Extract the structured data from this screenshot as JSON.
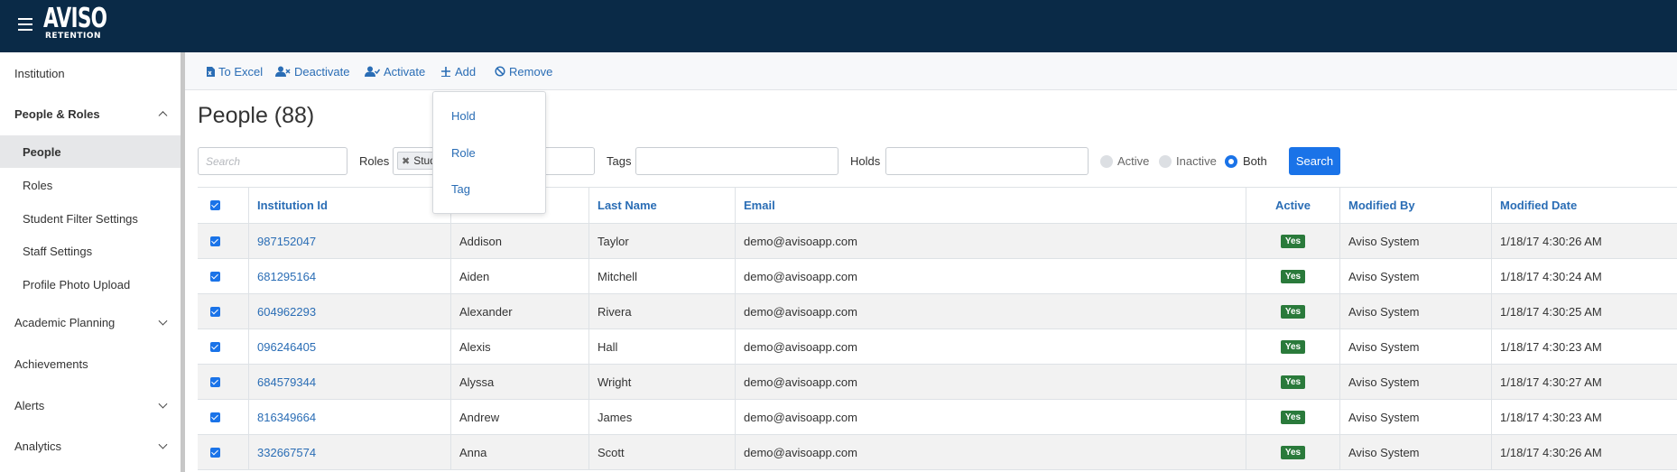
{
  "app": {
    "logo_main": "AVISO",
    "logo_sub": "RETENTION"
  },
  "toolbar": {
    "to_excel": "To Excel",
    "deactivate": "Deactivate",
    "activate": "Activate",
    "add": "Add",
    "remove": "Remove"
  },
  "add_menu": {
    "items": [
      "Hold",
      "Role",
      "Tag"
    ]
  },
  "sidebar": {
    "institution": "Institution",
    "people_roles": "People & Roles",
    "people": "People",
    "roles": "Roles",
    "student_filter_settings": "Student Filter Settings",
    "staff_settings": "Staff Settings",
    "profile_photo_upload": "Profile Photo Upload",
    "academic_planning": "Academic Planning",
    "achievements": "Achievements",
    "alerts": "Alerts",
    "analytics": "Analytics"
  },
  "page": {
    "title": "People (88)"
  },
  "filters": {
    "search_placeholder": "Search",
    "roles_label": "Roles",
    "roles_chip": "Stud",
    "tags_label": "Tags",
    "holds_label": "Holds",
    "status_options": [
      "Active",
      "Inactive",
      "Both"
    ],
    "status_selected": "Both",
    "search_button": "Search"
  },
  "table": {
    "headers": {
      "institution_id": "Institution Id",
      "last_name": "Last Name",
      "email": "Email",
      "active": "Active",
      "modified_by": "Modified By",
      "modified_date": "Modified Date"
    },
    "rows": [
      {
        "id": "987152047",
        "first": "Addison",
        "last": "Taylor",
        "email": "demo@avisoapp.com",
        "active": "Yes",
        "modified_by": "Aviso System",
        "modified_date": "1/18/17 4:30:26 AM"
      },
      {
        "id": "681295164",
        "first": "Aiden",
        "last": "Mitchell",
        "email": "demo@avisoapp.com",
        "active": "Yes",
        "modified_by": "Aviso System",
        "modified_date": "1/18/17 4:30:24 AM"
      },
      {
        "id": "604962293",
        "first": "Alexander",
        "last": "Rivera",
        "email": "demo@avisoapp.com",
        "active": "Yes",
        "modified_by": "Aviso System",
        "modified_date": "1/18/17 4:30:25 AM"
      },
      {
        "id": "096246405",
        "first": "Alexis",
        "last": "Hall",
        "email": "demo@avisoapp.com",
        "active": "Yes",
        "modified_by": "Aviso System",
        "modified_date": "1/18/17 4:30:23 AM"
      },
      {
        "id": "684579344",
        "first": "Alyssa",
        "last": "Wright",
        "email": "demo@avisoapp.com",
        "active": "Yes",
        "modified_by": "Aviso System",
        "modified_date": "1/18/17 4:30:27 AM"
      },
      {
        "id": "816349664",
        "first": "Andrew",
        "last": "James",
        "email": "demo@avisoapp.com",
        "active": "Yes",
        "modified_by": "Aviso System",
        "modified_date": "1/18/17 4:30:23 AM"
      },
      {
        "id": "332667574",
        "first": "Anna",
        "last": "Scott",
        "email": "demo@avisoapp.com",
        "active": "Yes",
        "modified_by": "Aviso System",
        "modified_date": "1/18/17 4:30:26 AM"
      }
    ]
  }
}
